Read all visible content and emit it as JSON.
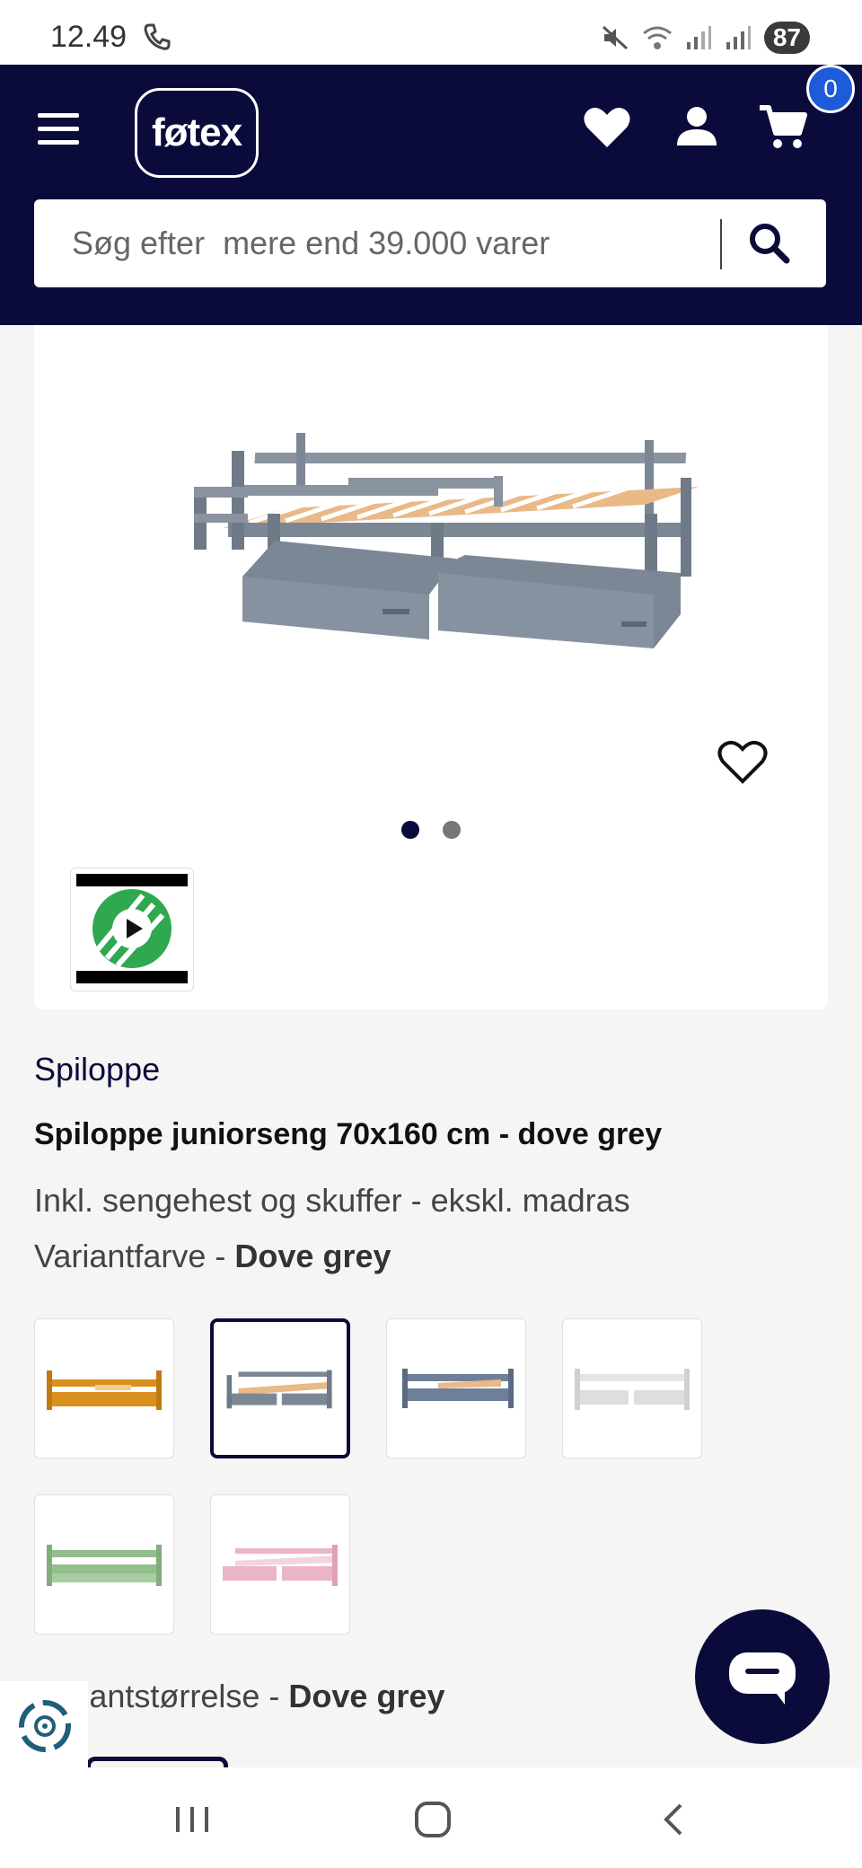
{
  "status_bar": {
    "time": "12.49",
    "battery": "87"
  },
  "header": {
    "logo_text": "føtex",
    "cart_count": "0"
  },
  "search": {
    "placeholder": "Søg efter  mere end 39.000 varer"
  },
  "product": {
    "brand": "Spiloppe",
    "title": "Spiloppe juniorseng 70x160 cm - dove grey",
    "subtitle": "Inkl. sengehest og skuffer - ekskl. madras",
    "variant_color_label": "Variantfarve - ",
    "variant_color_value": "Dove grey",
    "variant_size_label": "Variantstørrelse - ",
    "variant_size_value": "Dove grey"
  },
  "gallery": {
    "image_count": 2,
    "active_index": 0
  },
  "swatches": [
    {
      "name": "honey",
      "color": "#d9901f",
      "selected": false
    },
    {
      "name": "dove-grey",
      "color": "#7c8796",
      "selected": true
    },
    {
      "name": "blue-grey",
      "color": "#6e7f99",
      "selected": false
    },
    {
      "name": "white",
      "color": "#e6e6e6",
      "selected": false
    },
    {
      "name": "green",
      "color": "#93bf8e",
      "selected": false
    },
    {
      "name": "pink",
      "color": "#eab5c6",
      "selected": false
    }
  ],
  "colors": {
    "brand_navy": "#0b0b3b",
    "badge_blue": "#1e5bd8"
  },
  "icons": [
    "menu-icon",
    "heart-icon",
    "user-icon",
    "cart-icon",
    "search-icon",
    "play-icon",
    "chat-icon",
    "recycle-icon"
  ]
}
